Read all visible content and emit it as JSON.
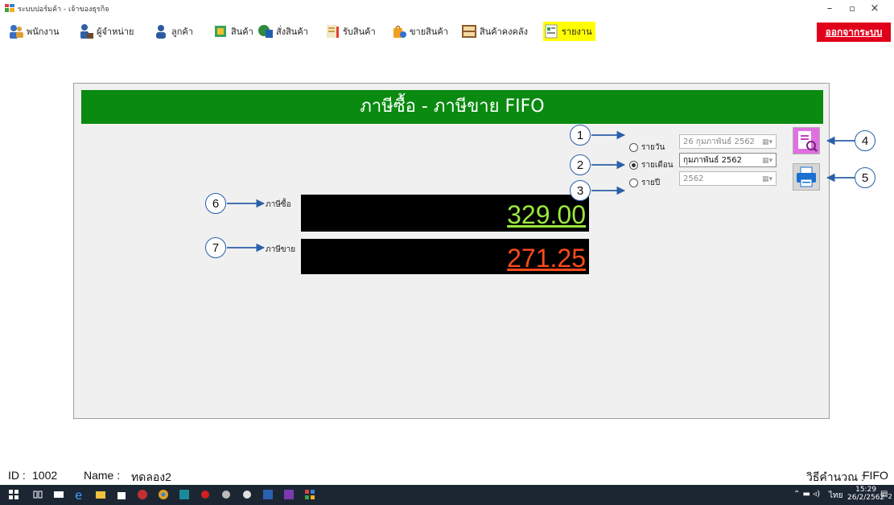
{
  "window": {
    "title": "ระบบปอร์มค้า - เจ้าของธุรกิจ",
    "minimize_icon": "minimize-icon",
    "maximize_icon": "maximize-icon",
    "close_icon": "close-icon"
  },
  "menu": {
    "items": [
      {
        "label": "พนักงาน",
        "icon": "employee-icon"
      },
      {
        "label": "ผู้จำหน่าย",
        "icon": "supplier-icon"
      },
      {
        "label": "ลูกค้า",
        "icon": "customer-icon"
      },
      {
        "label": "สินค้า",
        "icon": "product-icon"
      },
      {
        "label": "สั่งสินค้า",
        "icon": "order-icon"
      },
      {
        "label": "รับสินค้า",
        "icon": "receive-icon"
      },
      {
        "label": "ขายสินค้า",
        "icon": "sell-icon"
      },
      {
        "label": "สินค้าคงคลัง",
        "icon": "inventory-icon"
      },
      {
        "label": "รายงาน",
        "icon": "report-icon"
      }
    ],
    "logout_label": "ออกจากระบบ"
  },
  "report": {
    "title": "ภาษีซื้อ - ภาษีขาย FIFO",
    "period_options": [
      {
        "label": "รายวัน",
        "value": "26 กุมภาพันธ์  2562",
        "selected": false
      },
      {
        "label": "รายเดือน",
        "value": "กุมภาพันธ์  2562",
        "selected": true
      },
      {
        "label": "รายปี",
        "value": "2562",
        "selected": false
      }
    ],
    "purchase_tax_label": "ภาษีซื้อ",
    "purchase_tax_value": "329.00",
    "sales_tax_label": "ภาษีขาย",
    "sales_tax_value": "271.25",
    "colors": {
      "header": "#0a8a10",
      "purchase": "#9be83c",
      "sales": "#ff4a1a"
    }
  },
  "callouts": [
    "1",
    "2",
    "3",
    "4",
    "5",
    "6",
    "7"
  ],
  "status": {
    "id_label": "ID :",
    "id_value": "1002",
    "name_label": "Name :",
    "name_value": "ทดลอง2",
    "method_label": "วิธีคำนวณ :",
    "method_value": "FIFO"
  },
  "taskbar": {
    "clock_time": "15:29",
    "clock_date": "26/2/2562",
    "language": "ไทย",
    "notification_count": "2"
  }
}
